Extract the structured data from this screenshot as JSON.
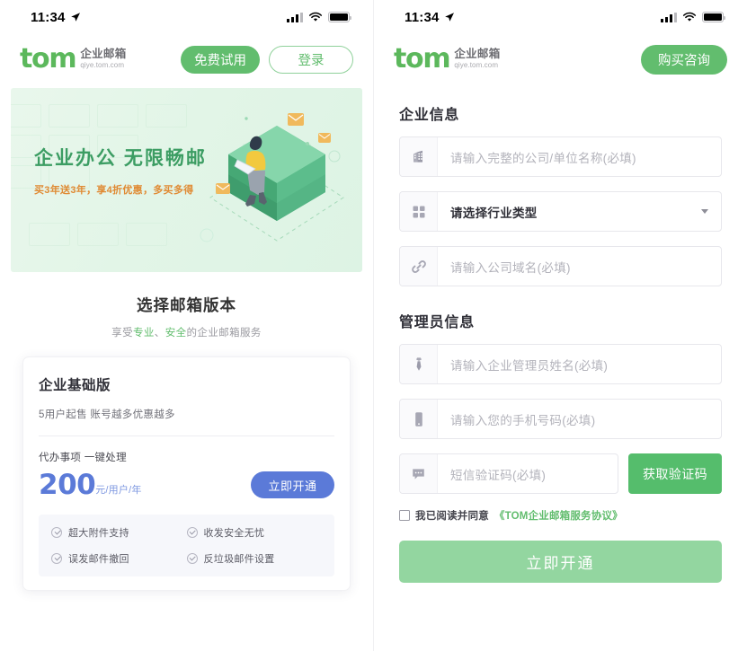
{
  "status_bar": {
    "time": "11:34",
    "location_icon": "location-arrow-icon",
    "signal_icon": "cellular-signal-icon",
    "wifi_icon": "wifi-icon",
    "battery_icon": "battery-full-icon"
  },
  "brand": {
    "name": "tom",
    "cn": "企业邮箱",
    "domain": "qiye.tom.com"
  },
  "colors": {
    "green": "#62bd6e",
    "green_light": "#93d6a0",
    "blue": "#5b7ad8",
    "orange": "#e08a33",
    "banner_bg": "#e4f5e9"
  },
  "left": {
    "header": {
      "trial_button": "免费试用",
      "login_button": "登录"
    },
    "banner": {
      "title": "企业办公 无限畅邮",
      "subtitle": "买3年送3年，享4折优惠，多买多得"
    },
    "section": {
      "title": "选择邮箱版本",
      "sub_pre": "享受",
      "sub_hl1": "专业",
      "sub_mid": "、",
      "sub_hl2": "安全",
      "sub_post": "的企业邮箱服务"
    },
    "plan": {
      "title": "企业基础版",
      "desc": "5用户起售 账号越多优惠越多",
      "feature_line": "代办事项 一键处理",
      "price": "200",
      "price_unit": "元/用户/年",
      "cta": "立即开通",
      "features": [
        {
          "label": "超大附件支持",
          "icon": "check-circle-icon"
        },
        {
          "label": "收发安全无忧",
          "icon": "check-circle-icon"
        },
        {
          "label": "误发邮件撤回",
          "icon": "check-circle-icon"
        },
        {
          "label": "反垃圾邮件设置",
          "icon": "check-circle-icon"
        }
      ]
    }
  },
  "right": {
    "header": {
      "consult_button": "购买咨询"
    },
    "company_section": {
      "title": "企业信息"
    },
    "admin_section": {
      "title": "管理员信息"
    },
    "fields": {
      "company_name": {
        "placeholder": "请输入完整的公司/单位名称(必填)",
        "value": "",
        "icon": "building-icon"
      },
      "industry": {
        "selected": "请选择行业类型",
        "icon": "grid-icon",
        "caret": "chevron-down-icon"
      },
      "domain": {
        "placeholder": "请输入公司域名(必填)",
        "value": "",
        "icon": "link-icon"
      },
      "admin_name": {
        "placeholder": "请输入企业管理员姓名(必填)",
        "value": "",
        "icon": "necktie-icon"
      },
      "phone": {
        "placeholder": "请输入您的手机号码(必填)",
        "value": "",
        "icon": "mobile-phone-icon"
      },
      "sms_code": {
        "placeholder": "短信验证码(必填)",
        "value": "",
        "icon": "message-bubble-icon"
      }
    },
    "get_code_button": "获取验证码",
    "agreement": {
      "text": "我已阅读并同意",
      "link": "《TOM企业邮箱服务协议》",
      "checked": false
    },
    "submit_button": "立即开通"
  }
}
